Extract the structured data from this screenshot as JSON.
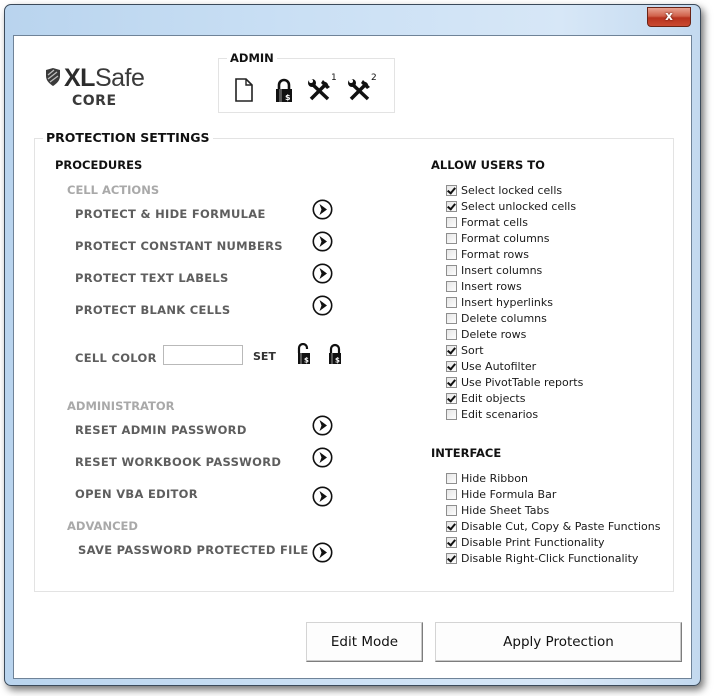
{
  "window": {
    "close_label": "x"
  },
  "logo": {
    "brand_bold": "XL",
    "brand_rest": "Safe",
    "sub": "CORE"
  },
  "admin": {
    "title": "ADMIN",
    "icons": [
      {
        "name": "new-file-icon",
        "superscript": ""
      },
      {
        "name": "padlock-icon",
        "superscript": ""
      },
      {
        "name": "tools-icon",
        "superscript": "1"
      },
      {
        "name": "tools-icon",
        "superscript": "2"
      }
    ]
  },
  "protection": {
    "title": "PROTECTION SETTINGS",
    "procedures": {
      "title": "PROCEDURES",
      "cell_actions": {
        "title": "CELL ACTIONS",
        "items": [
          "PROTECT & HIDE FORMULAE",
          "PROTECT CONSTANT NUMBERS",
          "PROTECT TEXT LABELS",
          "PROTECT BLANK CELLS"
        ]
      },
      "cell_color": {
        "label": "CELL COLOR",
        "value": "",
        "set_label": "SET"
      },
      "administrator": {
        "title": "ADMINISTRATOR",
        "items": [
          "RESET ADMIN PASSWORD",
          "RESET WORKBOOK PASSWORD",
          "OPEN VBA EDITOR"
        ]
      },
      "advanced": {
        "title": "ADVANCED",
        "items": [
          "SAVE PASSWORD PROTECTED FILE"
        ]
      }
    },
    "allow_users": {
      "title": "ALLOW USERS TO",
      "options": [
        {
          "label": "Select locked cells",
          "checked": true
        },
        {
          "label": "Select unlocked cells",
          "checked": true
        },
        {
          "label": "Format cells",
          "checked": false
        },
        {
          "label": "Format columns",
          "checked": false
        },
        {
          "label": "Format rows",
          "checked": false
        },
        {
          "label": "Insert columns",
          "checked": false
        },
        {
          "label": "Insert rows",
          "checked": false
        },
        {
          "label": "Insert hyperlinks",
          "checked": false
        },
        {
          "label": "Delete columns",
          "checked": false
        },
        {
          "label": "Delete rows",
          "checked": false
        },
        {
          "label": "Sort",
          "checked": true
        },
        {
          "label": "Use Autofilter",
          "checked": true
        },
        {
          "label": "Use PivotTable reports",
          "checked": true
        },
        {
          "label": "Edit objects",
          "checked": true
        },
        {
          "label": "Edit scenarios",
          "checked": false
        }
      ]
    },
    "interface": {
      "title": "INTERFACE",
      "options": [
        {
          "label": "Hide Ribbon",
          "checked": false
        },
        {
          "label": "Hide Formula Bar",
          "checked": false
        },
        {
          "label": "Hide Sheet Tabs",
          "checked": false
        },
        {
          "label": "Disable Cut, Copy & Paste Functions",
          "checked": true
        },
        {
          "label": "Disable Print Functionality",
          "checked": true
        },
        {
          "label": "Disable Right-Click Functionality",
          "checked": true
        }
      ]
    }
  },
  "buttons": {
    "edit_mode": "Edit Mode",
    "apply_protection": "Apply Protection"
  }
}
